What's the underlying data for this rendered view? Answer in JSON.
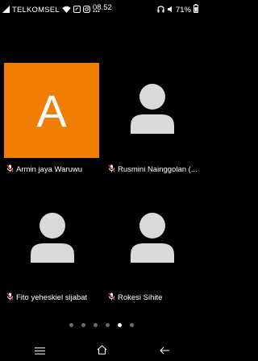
{
  "status_bar": {
    "carrier": "TELKOMSEL",
    "time": "08.52",
    "battery": "71%"
  },
  "participants": [
    {
      "name": "Armin jaya Waruwu",
      "avatar_letter": "A",
      "avatar_color": "#f07d04",
      "muted": true
    },
    {
      "name": "Rusmini Nainggolan (...",
      "muted": true
    },
    {
      "name": "Fito yeheskiel sijabat",
      "muted": true
    },
    {
      "name": "Rokesi Sihite",
      "muted": true
    }
  ],
  "pager": {
    "pages": 6,
    "current_page": 5
  },
  "colors": {
    "background": "#000000",
    "placeholder": "#d9d9d9",
    "mic_muted": "#e04848"
  }
}
